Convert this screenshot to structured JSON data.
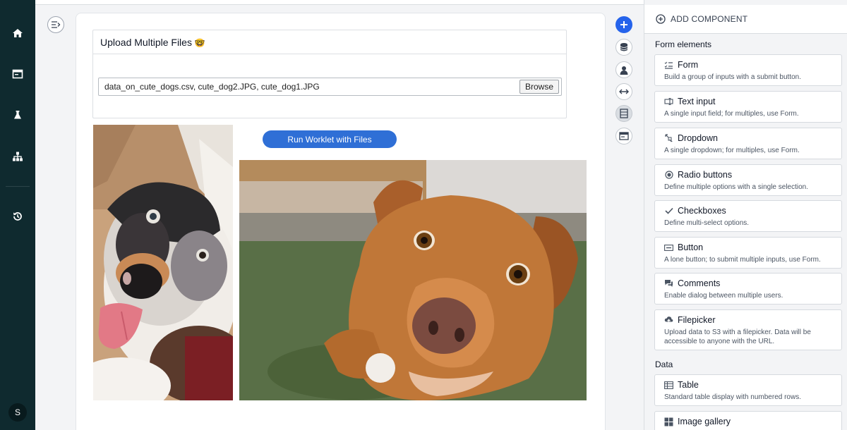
{
  "nav": {
    "items": [
      "home-icon",
      "browser-icon",
      "flask-icon",
      "sitemap-icon",
      "history-icon"
    ],
    "avatar_initial": "S"
  },
  "upload": {
    "title": "Upload Multiple Files",
    "title_emoji": "🤓",
    "files_value": "data_on_cute_dogs.csv, cute_dog2.JPG, cute_dog1.JPG",
    "browse_label": "Browse"
  },
  "run_button_label": "Run Worklet with Files",
  "images": [
    "cute_dog2.JPG",
    "cute_dog1.JPG"
  ],
  "panel": {
    "header": "ADD COMPONENT",
    "sections": [
      {
        "title": "Form elements",
        "items": [
          {
            "name": "Form",
            "desc": "Build a group of inputs with a submit button.",
            "icon": "form-icon"
          },
          {
            "name": "Text input",
            "desc": "A single input field; for multiples, use Form.",
            "icon": "text-input-icon"
          },
          {
            "name": "Dropdown",
            "desc": "A single dropdown; for multiples, use Form.",
            "icon": "dropdown-icon"
          },
          {
            "name": "Radio buttons",
            "desc": "Define multiple options with a single selection.",
            "icon": "radio-icon"
          },
          {
            "name": "Checkboxes",
            "desc": "Define multi-select options.",
            "icon": "check-icon"
          },
          {
            "name": "Button",
            "desc": "A lone button; to submit multiple inputs, use Form.",
            "icon": "button-icon"
          },
          {
            "name": "Comments",
            "desc": "Enable dialog between multiple users.",
            "icon": "comments-icon"
          },
          {
            "name": "Filepicker",
            "desc": "Upload data to S3 with a filepicker. Data will be accessible to anyone with the URL.",
            "icon": "upload-icon"
          }
        ]
      },
      {
        "title": "Data",
        "items": [
          {
            "name": "Table",
            "desc": "Standard table display with numbered rows.",
            "icon": "table-icon"
          },
          {
            "name": "Image gallery",
            "desc": "",
            "icon": "gallery-icon"
          }
        ]
      }
    ]
  }
}
